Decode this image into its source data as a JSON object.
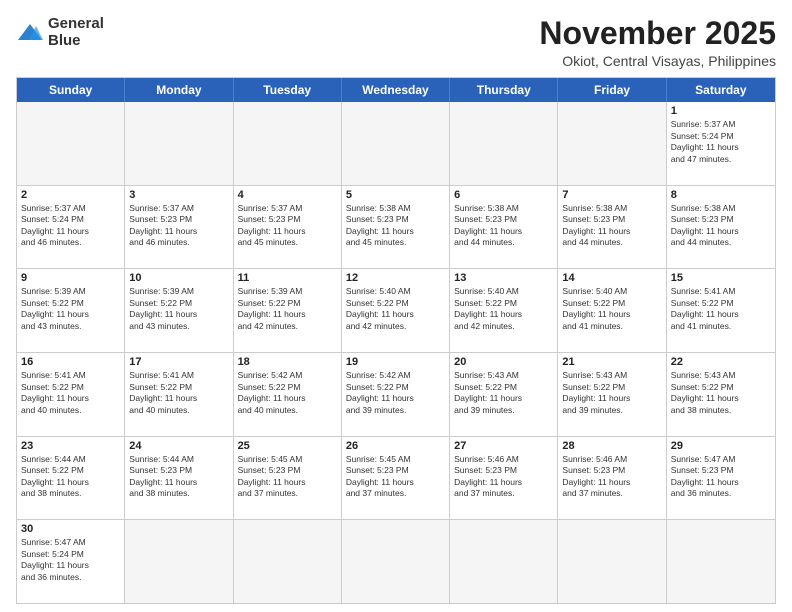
{
  "logo": {
    "line1": "General",
    "line2": "Blue"
  },
  "title": "November 2025",
  "subtitle": "Okiot, Central Visayas, Philippines",
  "days": [
    "Sunday",
    "Monday",
    "Tuesday",
    "Wednesday",
    "Thursday",
    "Friday",
    "Saturday"
  ],
  "weeks": [
    [
      {
        "day": "",
        "text": ""
      },
      {
        "day": "",
        "text": ""
      },
      {
        "day": "",
        "text": ""
      },
      {
        "day": "",
        "text": ""
      },
      {
        "day": "",
        "text": ""
      },
      {
        "day": "",
        "text": ""
      },
      {
        "day": "1",
        "text": "Sunrise: 5:37 AM\nSunset: 5:24 PM\nDaylight: 11 hours\nand 47 minutes."
      }
    ],
    [
      {
        "day": "2",
        "text": "Sunrise: 5:37 AM\nSunset: 5:24 PM\nDaylight: 11 hours\nand 46 minutes."
      },
      {
        "day": "3",
        "text": "Sunrise: 5:37 AM\nSunset: 5:23 PM\nDaylight: 11 hours\nand 46 minutes."
      },
      {
        "day": "4",
        "text": "Sunrise: 5:37 AM\nSunset: 5:23 PM\nDaylight: 11 hours\nand 45 minutes."
      },
      {
        "day": "5",
        "text": "Sunrise: 5:38 AM\nSunset: 5:23 PM\nDaylight: 11 hours\nand 45 minutes."
      },
      {
        "day": "6",
        "text": "Sunrise: 5:38 AM\nSunset: 5:23 PM\nDaylight: 11 hours\nand 44 minutes."
      },
      {
        "day": "7",
        "text": "Sunrise: 5:38 AM\nSunset: 5:23 PM\nDaylight: 11 hours\nand 44 minutes."
      },
      {
        "day": "8",
        "text": "Sunrise: 5:38 AM\nSunset: 5:23 PM\nDaylight: 11 hours\nand 44 minutes."
      }
    ],
    [
      {
        "day": "9",
        "text": "Sunrise: 5:39 AM\nSunset: 5:22 PM\nDaylight: 11 hours\nand 43 minutes."
      },
      {
        "day": "10",
        "text": "Sunrise: 5:39 AM\nSunset: 5:22 PM\nDaylight: 11 hours\nand 43 minutes."
      },
      {
        "day": "11",
        "text": "Sunrise: 5:39 AM\nSunset: 5:22 PM\nDaylight: 11 hours\nand 42 minutes."
      },
      {
        "day": "12",
        "text": "Sunrise: 5:40 AM\nSunset: 5:22 PM\nDaylight: 11 hours\nand 42 minutes."
      },
      {
        "day": "13",
        "text": "Sunrise: 5:40 AM\nSunset: 5:22 PM\nDaylight: 11 hours\nand 42 minutes."
      },
      {
        "day": "14",
        "text": "Sunrise: 5:40 AM\nSunset: 5:22 PM\nDaylight: 11 hours\nand 41 minutes."
      },
      {
        "day": "15",
        "text": "Sunrise: 5:41 AM\nSunset: 5:22 PM\nDaylight: 11 hours\nand 41 minutes."
      }
    ],
    [
      {
        "day": "16",
        "text": "Sunrise: 5:41 AM\nSunset: 5:22 PM\nDaylight: 11 hours\nand 40 minutes."
      },
      {
        "day": "17",
        "text": "Sunrise: 5:41 AM\nSunset: 5:22 PM\nDaylight: 11 hours\nand 40 minutes."
      },
      {
        "day": "18",
        "text": "Sunrise: 5:42 AM\nSunset: 5:22 PM\nDaylight: 11 hours\nand 40 minutes."
      },
      {
        "day": "19",
        "text": "Sunrise: 5:42 AM\nSunset: 5:22 PM\nDaylight: 11 hours\nand 39 minutes."
      },
      {
        "day": "20",
        "text": "Sunrise: 5:43 AM\nSunset: 5:22 PM\nDaylight: 11 hours\nand 39 minutes."
      },
      {
        "day": "21",
        "text": "Sunrise: 5:43 AM\nSunset: 5:22 PM\nDaylight: 11 hours\nand 39 minutes."
      },
      {
        "day": "22",
        "text": "Sunrise: 5:43 AM\nSunset: 5:22 PM\nDaylight: 11 hours\nand 38 minutes."
      }
    ],
    [
      {
        "day": "23",
        "text": "Sunrise: 5:44 AM\nSunset: 5:22 PM\nDaylight: 11 hours\nand 38 minutes."
      },
      {
        "day": "24",
        "text": "Sunrise: 5:44 AM\nSunset: 5:23 PM\nDaylight: 11 hours\nand 38 minutes."
      },
      {
        "day": "25",
        "text": "Sunrise: 5:45 AM\nSunset: 5:23 PM\nDaylight: 11 hours\nand 37 minutes."
      },
      {
        "day": "26",
        "text": "Sunrise: 5:45 AM\nSunset: 5:23 PM\nDaylight: 11 hours\nand 37 minutes."
      },
      {
        "day": "27",
        "text": "Sunrise: 5:46 AM\nSunset: 5:23 PM\nDaylight: 11 hours\nand 37 minutes."
      },
      {
        "day": "28",
        "text": "Sunrise: 5:46 AM\nSunset: 5:23 PM\nDaylight: 11 hours\nand 37 minutes."
      },
      {
        "day": "29",
        "text": "Sunrise: 5:47 AM\nSunset: 5:23 PM\nDaylight: 11 hours\nand 36 minutes."
      }
    ],
    [
      {
        "day": "30",
        "text": "Sunrise: 5:47 AM\nSunset: 5:24 PM\nDaylight: 11 hours\nand 36 minutes."
      },
      {
        "day": "",
        "text": ""
      },
      {
        "day": "",
        "text": ""
      },
      {
        "day": "",
        "text": ""
      },
      {
        "day": "",
        "text": ""
      },
      {
        "day": "",
        "text": ""
      },
      {
        "day": "",
        "text": ""
      }
    ]
  ]
}
